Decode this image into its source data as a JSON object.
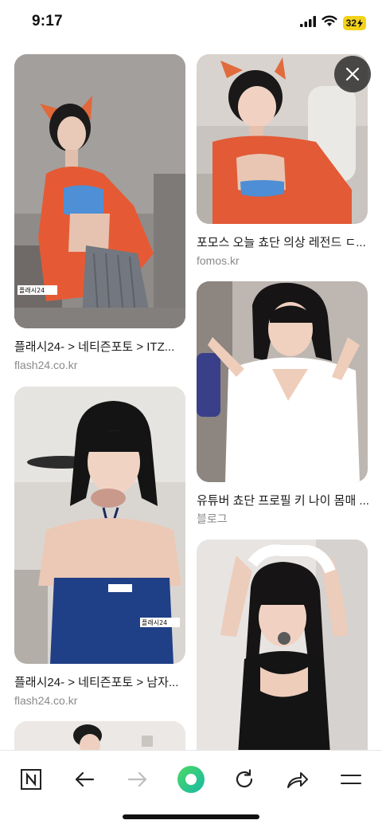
{
  "status": {
    "time": "9:17",
    "battery": "32"
  },
  "results": {
    "left": [
      {
        "title": "플래시24- > 네티즌포토 > ITZ...",
        "source": "flash24.co.kr",
        "overlay": "플래시24"
      },
      {
        "title": "플래시24- > 네티즌포토 > 남자...",
        "source": "flash24.co.kr",
        "overlay": "플래시24"
      }
    ],
    "right": [
      {
        "title": "포모스 오늘 쵸단 의상 레전드 ㄷ...",
        "source": "fomos.kr"
      },
      {
        "title": "유튜버 쵸단 프로필 키 나이 몸매 ...",
        "source": "블로그"
      }
    ]
  },
  "toolbar": {
    "items": [
      "naver-home-icon",
      "back-arrow-icon",
      "forward-arrow-icon",
      "green-dot-icon",
      "refresh-icon",
      "share-icon",
      "menu-icon"
    ],
    "accent": "#1ec800"
  }
}
